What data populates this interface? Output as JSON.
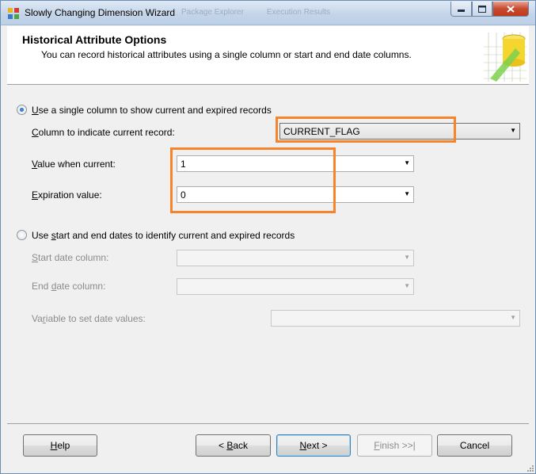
{
  "window": {
    "title": "Slowly Changing Dimension Wizard",
    "ghost_tab_1": "Package Explorer",
    "ghost_tab_2": "Execution Results",
    "minimize_icon": "minimize-icon",
    "maximize_icon": "maximize-icon",
    "close_icon": "close-icon"
  },
  "header": {
    "title": "Historical Attribute Options",
    "subtitle": "You can record historical attributes using a single column or start and end date columns."
  },
  "option_single": {
    "selected": true,
    "label_pre": "",
    "label_key": "U",
    "label_post": "se a single column to show current and expired records",
    "column_label_pre": "",
    "column_label_key": "C",
    "column_label_post": "olumn to indicate current record:",
    "column_value": "CURRENT_FLAG",
    "value_current_label_pre": "",
    "value_current_label_key": "V",
    "value_current_label_post": "alue when current:",
    "value_current": "1",
    "expiration_label_pre": "",
    "expiration_label_key": "E",
    "expiration_label_post": "xpiration value:",
    "expiration_value": "0"
  },
  "option_dates": {
    "selected": false,
    "label_pre": "Use ",
    "label_key": "s",
    "label_post": "tart and end dates to identify current and expired records",
    "start_label_pre": "",
    "start_label_key": "S",
    "start_label_post": "tart date column:",
    "end_label_pre": "End ",
    "end_label_key": "d",
    "end_label_post": "ate column:",
    "variable_label_pre": "Va",
    "variable_label_key": "r",
    "variable_label_post": "iable to set date values:"
  },
  "buttons": {
    "help_key": "H",
    "help_post": "elp",
    "back_pre": "< ",
    "back_key": "B",
    "back_post": "ack",
    "next_key": "N",
    "next_post": "ext >",
    "finish_key": "F",
    "finish_post": "inish >>|",
    "cancel": "Cancel"
  },
  "colors": {
    "highlight": "#f7842a",
    "radio_selected": "#0d4f9e"
  }
}
